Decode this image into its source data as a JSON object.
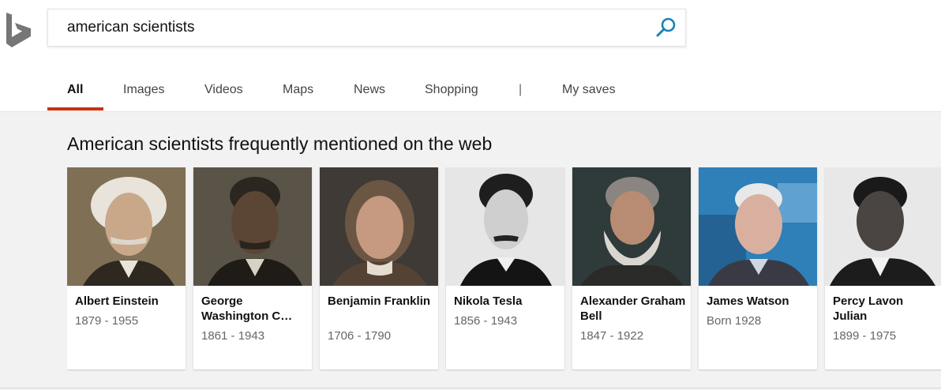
{
  "search": {
    "query": "american scientists"
  },
  "tabs": [
    {
      "label": "All"
    },
    {
      "label": "Images"
    },
    {
      "label": "Videos"
    },
    {
      "label": "Maps"
    },
    {
      "label": "News"
    },
    {
      "label": "Shopping"
    },
    {
      "label": "My saves"
    }
  ],
  "tab_separator": "|",
  "section": {
    "title": "American scientists frequently mentioned on the web"
  },
  "people": [
    {
      "name": "Albert Einstein",
      "dates": "1879 - 1955"
    },
    {
      "name": "George Washington C…",
      "dates": "1861 - 1943"
    },
    {
      "name": "Benjamin Franklin",
      "dates": "1706 - 1790"
    },
    {
      "name": "Nikola Tesla",
      "dates": "1856 - 1943"
    },
    {
      "name": "Alexander Graham Bell",
      "dates": "1847 - 1922"
    },
    {
      "name": "James Watson",
      "dates": "Born 1928"
    },
    {
      "name": "Percy Lavon Julian",
      "dates": "1899 - 1975"
    }
  ],
  "colors": {
    "accent_underline": "#c5340e",
    "search_icon": "#1883b5",
    "logo": "#767676",
    "content_bg": "#f2f2f2"
  }
}
